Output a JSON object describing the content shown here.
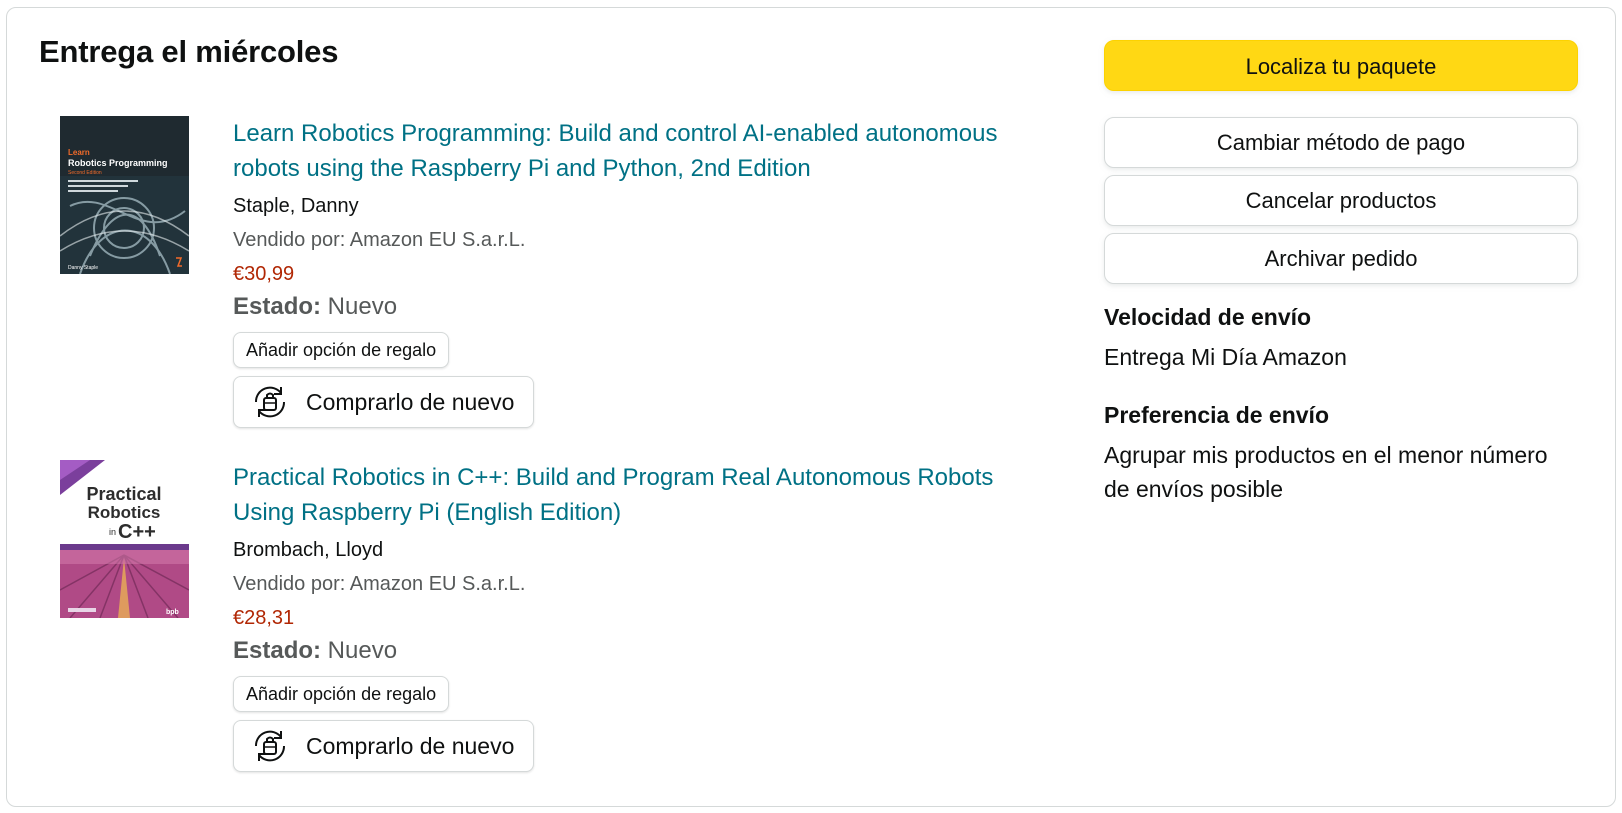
{
  "shipment": {
    "heading": "Entrega el miércoles"
  },
  "items": [
    {
      "title": "Learn Robotics Programming: Build and control AI-enabled autonomous robots using the Raspberry Pi and Python, 2nd Edition",
      "author": "Staple, Danny",
      "seller": "Vendido por: Amazon EU S.a.r.L.",
      "price": "€30,99",
      "status_label": "Estado:",
      "status_value": " Nuevo",
      "gift_label": "Añadir opción de regalo",
      "buy_again_label": "Comprarlo de nuevo",
      "cover": {
        "line1": "Learn",
        "line2": "Robotics Programming",
        "line3": "Second Edition",
        "author": "Danny Staple"
      }
    },
    {
      "title": "Practical Robotics in C++: Build and Program Real Autonomous Robots Using Raspberry Pi (English Edition)",
      "author": "Brombach, Lloyd",
      "seller": "Vendido por: Amazon EU S.a.r.L.",
      "price": "€28,31",
      "status_label": "Estado:",
      "status_value": " Nuevo",
      "gift_label": "Añadir opción de regalo",
      "buy_again_label": "Comprarlo de nuevo",
      "cover": {
        "line1": "Practical",
        "line2": "Robotics",
        "line3": "in",
        "line4": "C++"
      }
    }
  ],
  "actions": {
    "track": "Localiza tu paquete",
    "change_payment": "Cambiar método de pago",
    "cancel_items": "Cancelar productos",
    "archive_order": "Archivar pedido"
  },
  "shipping": {
    "speed_title": "Velocidad de envío",
    "speed_value": "Entrega Mi Día Amazon",
    "preference_title": "Preferencia de envío",
    "preference_value": "Agrupar mis productos en el menor número de envíos posible"
  },
  "colors": {
    "link": "#007185",
    "price": "#b12704",
    "primary_button": "#ffd814",
    "muted_text": "#565959"
  }
}
